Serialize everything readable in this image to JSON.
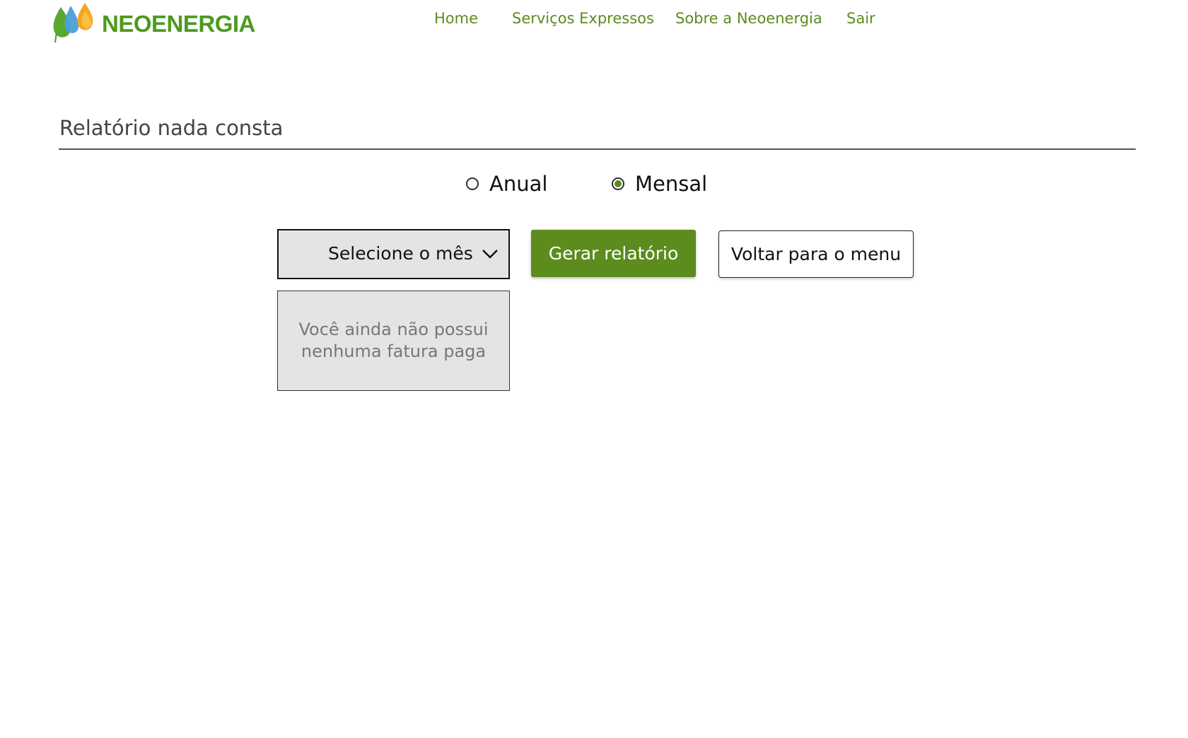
{
  "header": {
    "logo_text": "NEOENERGIA",
    "nav": [
      {
        "label": "Home"
      },
      {
        "label": "Serviços Expressos"
      },
      {
        "label": "Sobre a Neoenergia"
      },
      {
        "label": "Sair"
      }
    ]
  },
  "page": {
    "title": "Relatório nada consta"
  },
  "period": {
    "options": [
      {
        "label": "Anual",
        "checked": false
      },
      {
        "label": "Mensal",
        "checked": true
      }
    ]
  },
  "month_select": {
    "selected": "Selecione o mês"
  },
  "empty_notice": {
    "text": "Você ainda não possui nenhuma fatura paga"
  },
  "actions": {
    "generate_label": "Gerar relatório",
    "back_label": "Voltar para o menu"
  },
  "colors": {
    "brand_green": "#5b8c1d",
    "logo_green": "#4e9a1e",
    "panel_gray": "#e4e4e4"
  },
  "icons": {
    "logo": "neoenergia-drops-icon",
    "select_arrow": "chevron-down-icon"
  }
}
